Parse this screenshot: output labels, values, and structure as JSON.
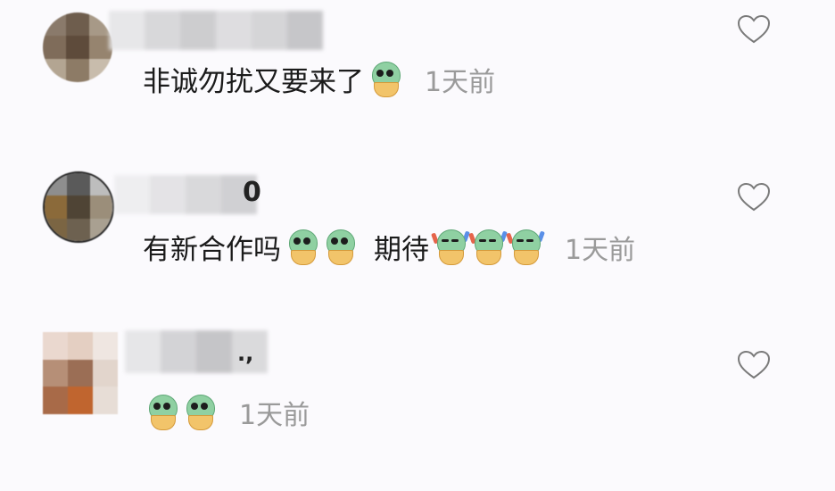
{
  "comments": [
    {
      "name_suffix": "",
      "text": "非诚勿扰又要来了",
      "emojis": [
        "smile-emoji"
      ],
      "time": "1天前"
    },
    {
      "name_suffix": "0",
      "text": "有新合作吗",
      "word": "期待",
      "time": "1天前"
    },
    {
      "name_suffix": ".,",
      "text": "",
      "time": "1天前"
    }
  ],
  "colors": {
    "background": "#fbfafd",
    "text": "#1b1b1b",
    "time": "#9a9a9a",
    "emoji_green": "#8fd0a2",
    "emoji_cup": "#f2c46a"
  },
  "icons": {
    "like": "heart-outline-icon"
  }
}
